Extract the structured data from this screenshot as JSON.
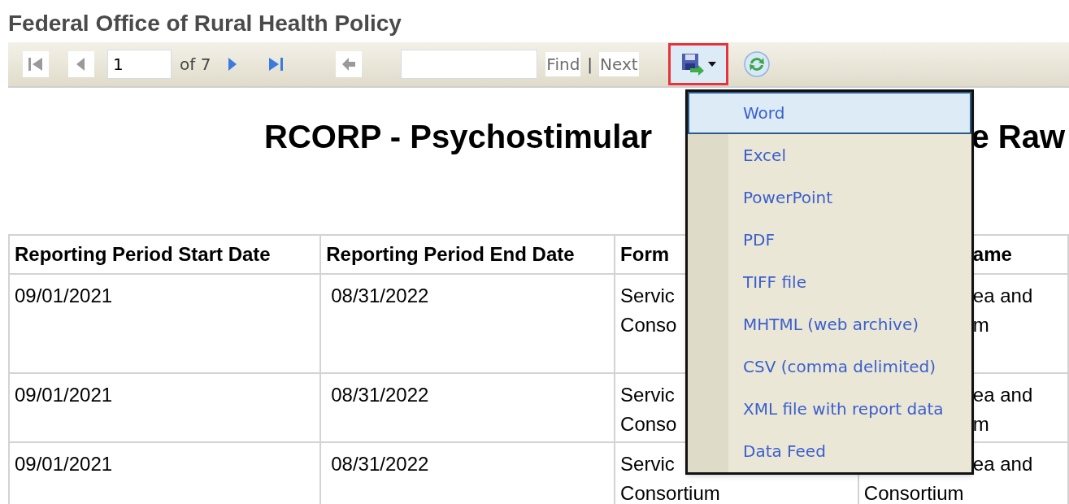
{
  "header": {
    "title": "Federal Office of Rural Health Policy"
  },
  "toolbar": {
    "first_page": {
      "disabled": true
    },
    "previous_page": {
      "disabled": true
    },
    "page_input": {
      "value": "1"
    },
    "page_count": "of 7",
    "next_page": {
      "disabled": false
    },
    "last_page": {
      "disabled": false
    },
    "back": {
      "disabled": true
    },
    "find": {
      "label": "Find",
      "disabled": true
    },
    "separator": "|",
    "find_next": {
      "label": "Next",
      "disabled": true
    },
    "export": {
      "highlighted": true,
      "expanded": true
    }
  },
  "export_menu": [
    {
      "label": "Word",
      "selected": true
    },
    {
      "label": "Excel",
      "selected": false
    },
    {
      "label": "PowerPoint",
      "selected": false
    },
    {
      "label": "PDF",
      "selected": false
    },
    {
      "label": "TIFF file",
      "selected": false
    },
    {
      "label": "MHTML (web archive)",
      "selected": false
    },
    {
      "label": "CSV (comma delimited)",
      "selected": false
    },
    {
      "label": "XML file with report data",
      "selected": false
    },
    {
      "label": "Data Feed",
      "selected": false
    }
  ],
  "report": {
    "title_parts": [
      "RCORP - Psychostimular",
      "e Raw"
    ]
  },
  "table": {
    "columns": [
      {
        "lines": [
          {
            "text": "Reporting Period Start Date",
            "kind": "full"
          }
        ]
      },
      {
        "lines": [
          {
            "text": "Reporting Period End Date",
            "kind": "full"
          }
        ]
      },
      {
        "lines": [
          {
            "text": "Form",
            "kind": "full"
          }
        ]
      },
      {
        "lines": [
          {
            "text": "ame",
            "kind": "fragment"
          }
        ]
      }
    ],
    "rows": [
      [
        {
          "lines": [
            {
              "text": "09/01/2021",
              "kind": "full"
            }
          ]
        },
        {
          "lines": [
            {
              "text": "08/31/2022",
              "kind": "full"
            }
          ]
        },
        {
          "lines": [
            {
              "text": "Servic",
              "kind": "full"
            },
            {
              "text": "Conso",
              "kind": "full"
            }
          ]
        },
        {
          "lines": [
            {
              "text": "ea and",
              "kind": "fragment"
            },
            {
              "text": "m",
              "kind": "fragment"
            }
          ]
        }
      ],
      [
        {
          "lines": [
            {
              "text": "09/01/2021",
              "kind": "full"
            }
          ]
        },
        {
          "lines": [
            {
              "text": "08/31/2022",
              "kind": "full"
            }
          ]
        },
        {
          "lines": [
            {
              "text": "Servic",
              "kind": "full"
            },
            {
              "text": "Conso",
              "kind": "full"
            }
          ]
        },
        {
          "lines": [
            {
              "text": "ea and",
              "kind": "fragment"
            },
            {
              "text": "m",
              "kind": "fragment"
            }
          ]
        }
      ],
      [
        {
          "lines": [
            {
              "text": "09/01/2021",
              "kind": "full"
            }
          ]
        },
        {
          "lines": [
            {
              "text": "08/31/2022",
              "kind": "full"
            }
          ]
        },
        {
          "lines": [
            {
              "text": "Servic",
              "kind": "full"
            },
            {
              "text": "Consortium",
              "kind": "full"
            }
          ]
        },
        {
          "lines": [
            {
              "text": "ea and",
              "kind": "fragment"
            },
            {
              "text": "Consortium",
              "kind": "full"
            }
          ]
        }
      ]
    ]
  }
}
